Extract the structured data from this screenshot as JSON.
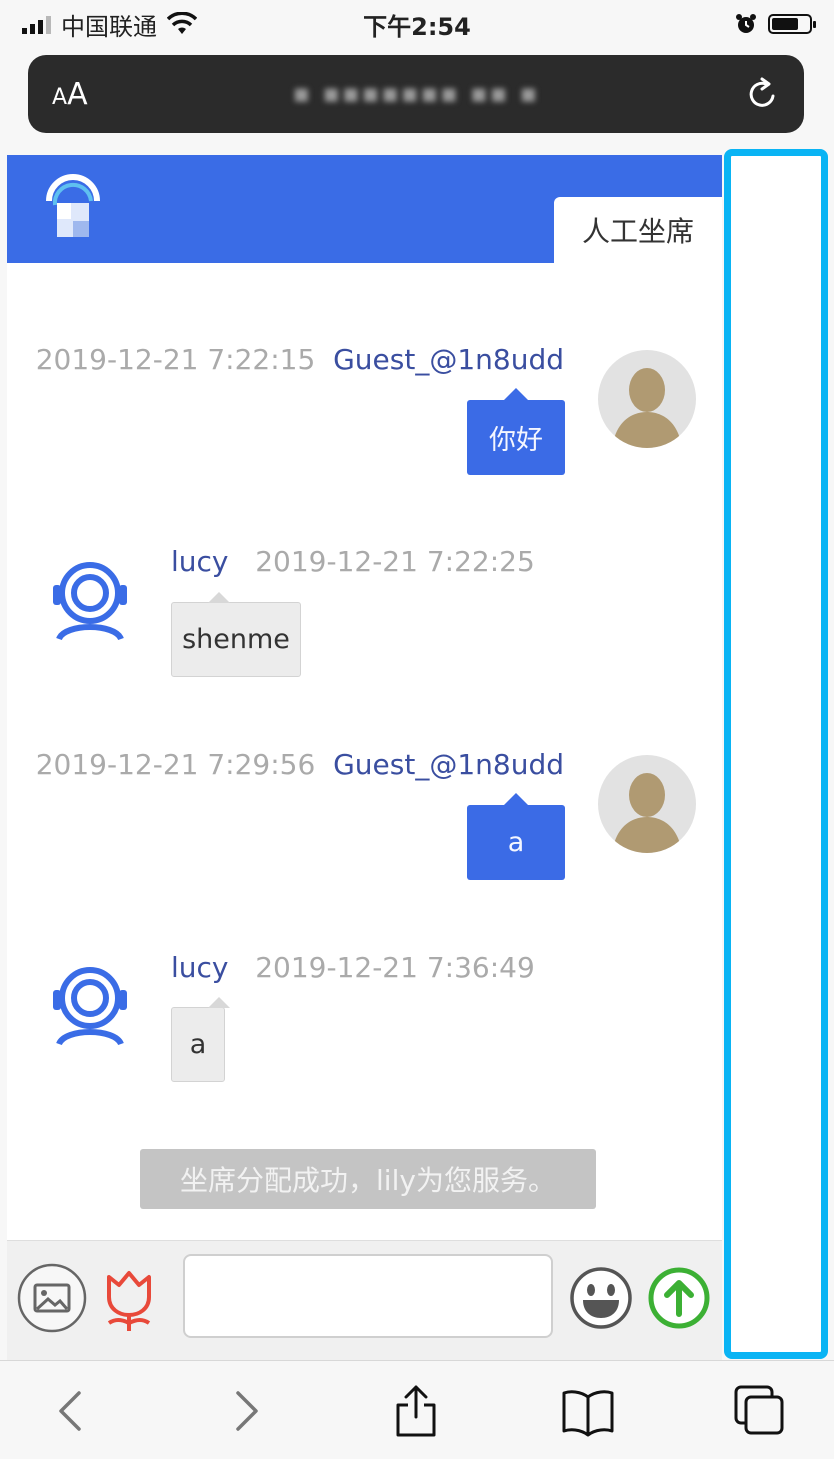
{
  "status_bar": {
    "carrier": "中国联通",
    "time": "下午2:54"
  },
  "url_bar": {
    "aa_label_small": "A",
    "aa_label_large": "A",
    "url": "▪ ▪▪▪▪▪▪▪ ▪▪ ▪"
  },
  "page": {
    "tab_label": "人工坐席",
    "messages": [
      {
        "sender": "Guest_@1n8udd",
        "time": "2019-12-21 7:22:15",
        "text": "你好"
      },
      {
        "sender": "lucy",
        "time": "2019-12-21 7:22:25",
        "text": "shenme"
      },
      {
        "sender": "Guest_@1n8udd",
        "time": "2019-12-21 7:29:56",
        "text": "a"
      },
      {
        "sender": "lucy",
        "time": "2019-12-21 7:36:49",
        "text": "a"
      }
    ],
    "system_notice": "坐席分配成功，lily为您服务。",
    "input": {
      "value": "",
      "placeholder": ""
    }
  },
  "colors": {
    "brand_blue": "#3a6ce6",
    "highlight_cyan": "#0ab4f4",
    "send_green": "#3cb034",
    "flower_red": "#e8493a"
  },
  "icons": {
    "input_bar": [
      "image-icon",
      "flower-icon",
      "emoji-icon",
      "send-arrow-icon"
    ],
    "toolbar": [
      "back-chevron-icon",
      "forward-chevron-icon",
      "share-icon",
      "bookmarks-icon",
      "tabs-icon"
    ]
  }
}
